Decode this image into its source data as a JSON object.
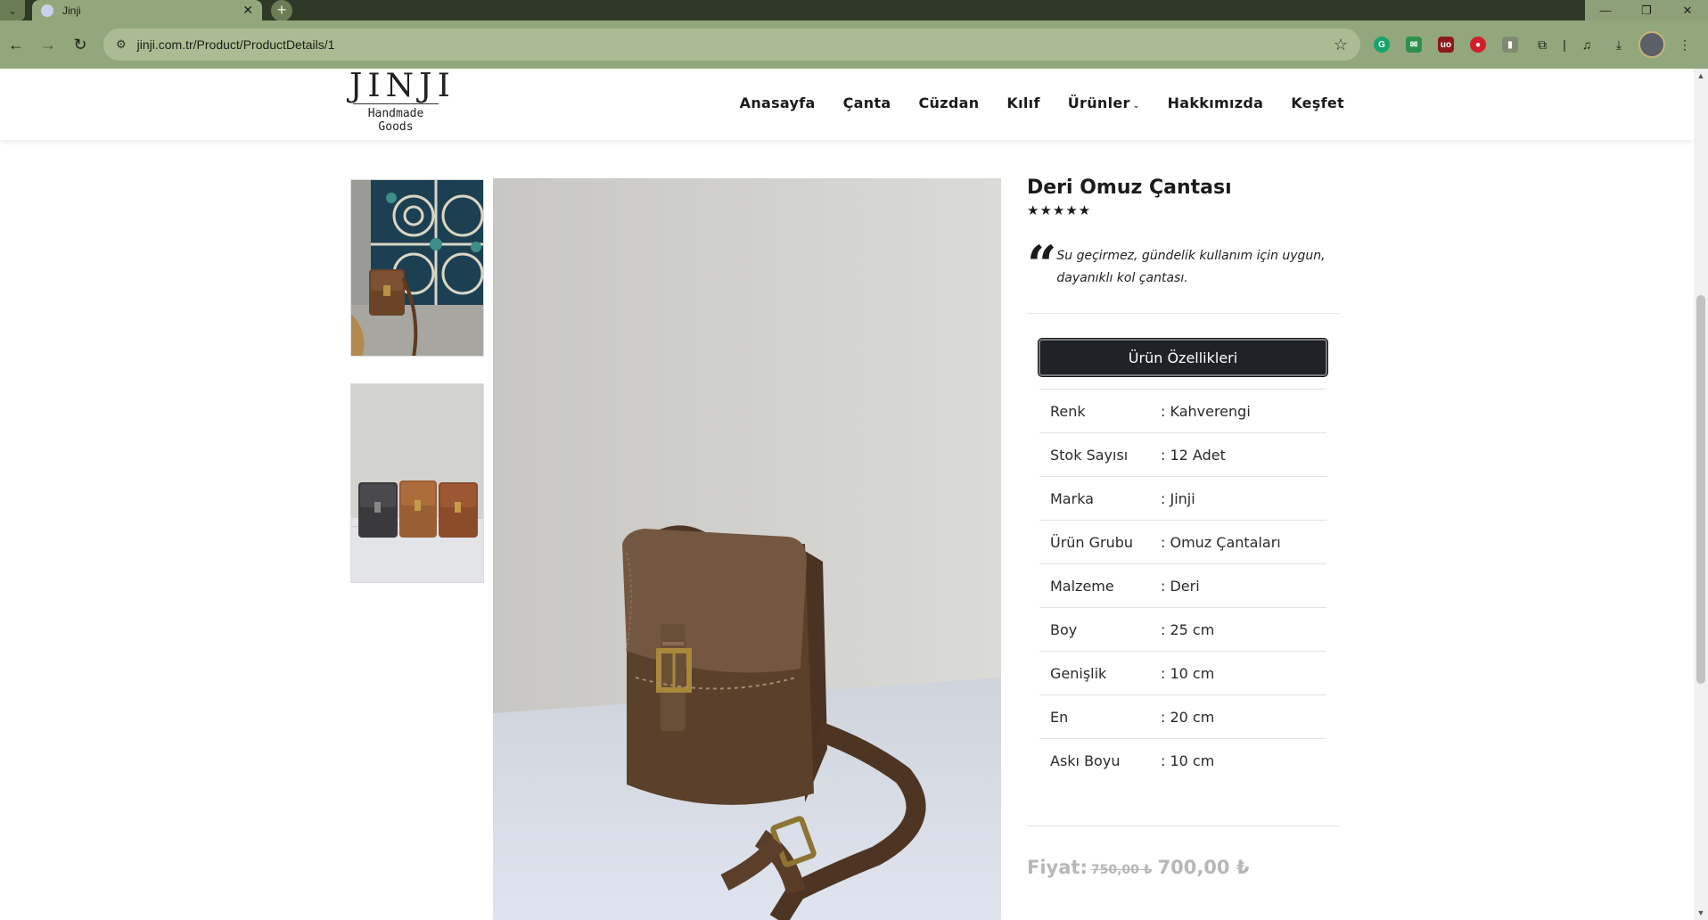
{
  "browser": {
    "tab_title": "Jinji",
    "url": "jinji.com.tr/Product/ProductDetails/1"
  },
  "site": {
    "logo_word": "JINJI",
    "logo_sub_1": "Handmade",
    "logo_sub_2": "Goods",
    "menu": [
      "Anasayfa",
      "Çanta",
      "Cüzdan",
      "Kılıf",
      "Ürünler",
      "Hakkımızda",
      "Keşfet"
    ]
  },
  "product": {
    "title": "Deri Omuz Çantası",
    "rating_stars": "★★★★★",
    "rating": 5,
    "description": "Su geçirmez, gündelik kullanım için uygun, dayanıklı kol çantası.",
    "specs_button": "Ürün Özellikleri",
    "specs": [
      {
        "key": "Renk",
        "value": ": Kahverengi"
      },
      {
        "key": "Stok Sayısı",
        "value": ": 12 Adet"
      },
      {
        "key": "Marka",
        "value": ": Jinji"
      },
      {
        "key": "Ürün Grubu",
        "value": ": Omuz Çantaları"
      },
      {
        "key": "Malzeme",
        "value": ": Deri"
      },
      {
        "key": "Boy",
        "value": ": 25 cm"
      },
      {
        "key": "Genişlik",
        "value": ": 10 cm"
      },
      {
        "key": "En",
        "value": ": 20 cm"
      },
      {
        "key": "Askı Boyu",
        "value": ": 10 cm"
      }
    ],
    "price_label": "Fiyat:",
    "old_price": "750,00 ₺",
    "new_price": "700,00 ₺"
  },
  "colors": {
    "chrome_bg": "#93a77c",
    "button_dark": "#1f2226",
    "price_grey": "#b7b7b7"
  }
}
